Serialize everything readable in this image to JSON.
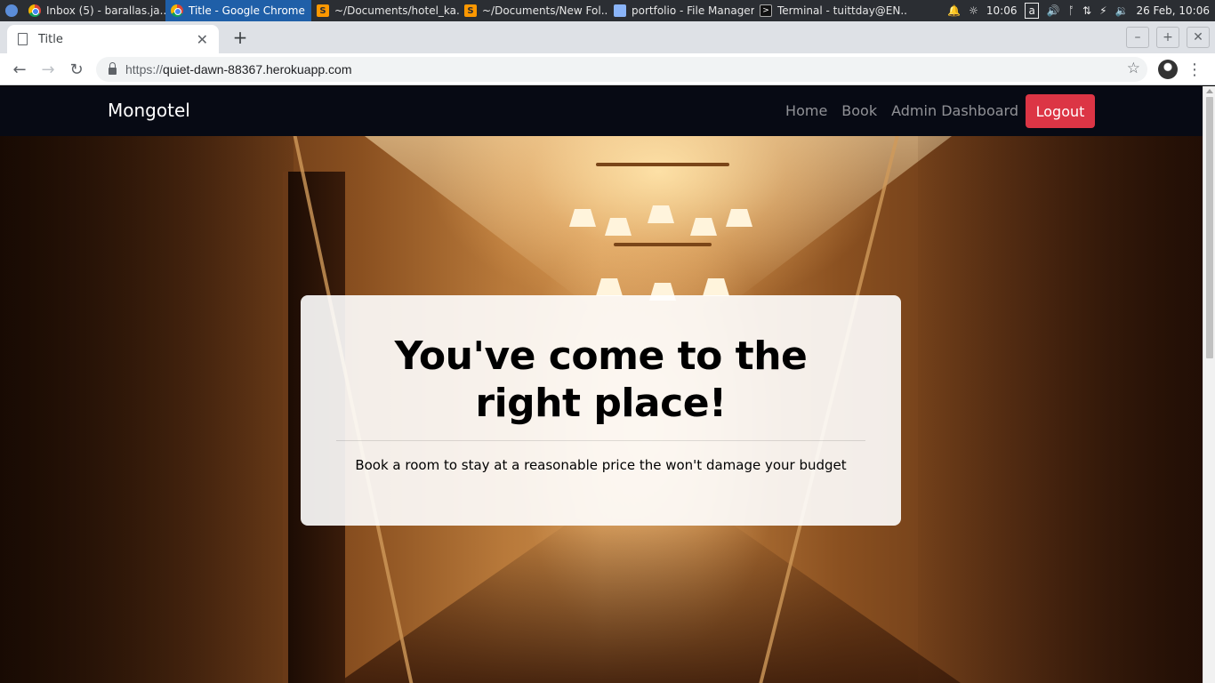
{
  "taskbar": {
    "tasks": [
      {
        "label": "Inbox (5) - barallas.ja...",
        "icon": "chrome-icon"
      },
      {
        "label": "Title - Google Chrome",
        "icon": "chrome-icon"
      },
      {
        "label": "~/Documents/hotel_ka...",
        "icon": "sublime-icon"
      },
      {
        "label": "~/Documents/New Fol...",
        "icon": "sublime-icon"
      },
      {
        "label": "portfolio - File Manager",
        "icon": "folder-icon"
      },
      {
        "label": "Terminal - tuittday@EN...",
        "icon": "terminal-icon"
      }
    ],
    "tray": {
      "time": "10:06",
      "keyboard": "a",
      "clock": "26 Feb, 10:06"
    }
  },
  "browser": {
    "tab_title": "Title",
    "url_scheme": "https://",
    "url_host": "quiet-dawn-88367.herokuapp.com"
  },
  "site": {
    "brand": "Mongotel",
    "nav": {
      "home": "Home",
      "book": "Book",
      "admin": "Admin Dashboard",
      "logout": "Logout"
    },
    "hero": {
      "title": "You've come to the right place!",
      "lead": "Book a room to stay at a reasonable price the won't damage your budget"
    }
  },
  "colors": {
    "navbar": "#070a14",
    "logout": "#dc3545",
    "taskbar": "#2b2e33",
    "active_task": "#1f5fa8"
  }
}
